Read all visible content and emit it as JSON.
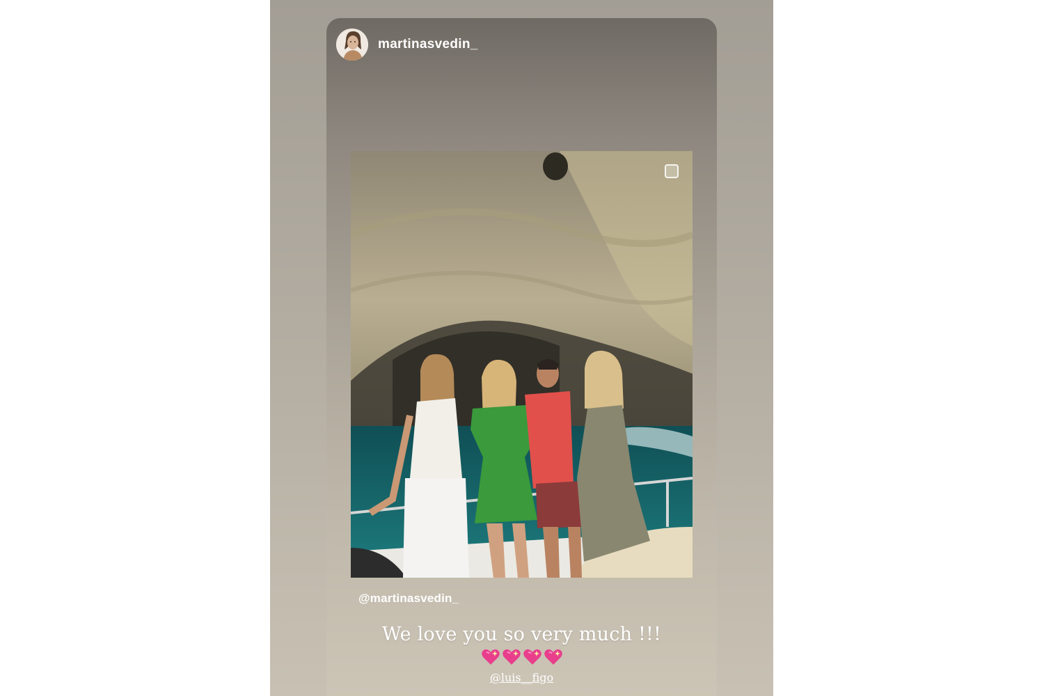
{
  "story": {
    "username": "martinasvedin_",
    "avatar_icon": "profile-avatar",
    "mention_tag": "@martinasvedin_",
    "caption": "We love you so very much !!!",
    "hearts": [
      "sparkling-heart",
      "sparkling-heart",
      "sparkling-heart",
      "sparkling-heart"
    ],
    "caption_mention": "@luis__figo"
  },
  "colors": {
    "outer_panel": "#aaa49a",
    "heart_pink": "#e83e8c",
    "heart_light": "#ff8fc8"
  }
}
